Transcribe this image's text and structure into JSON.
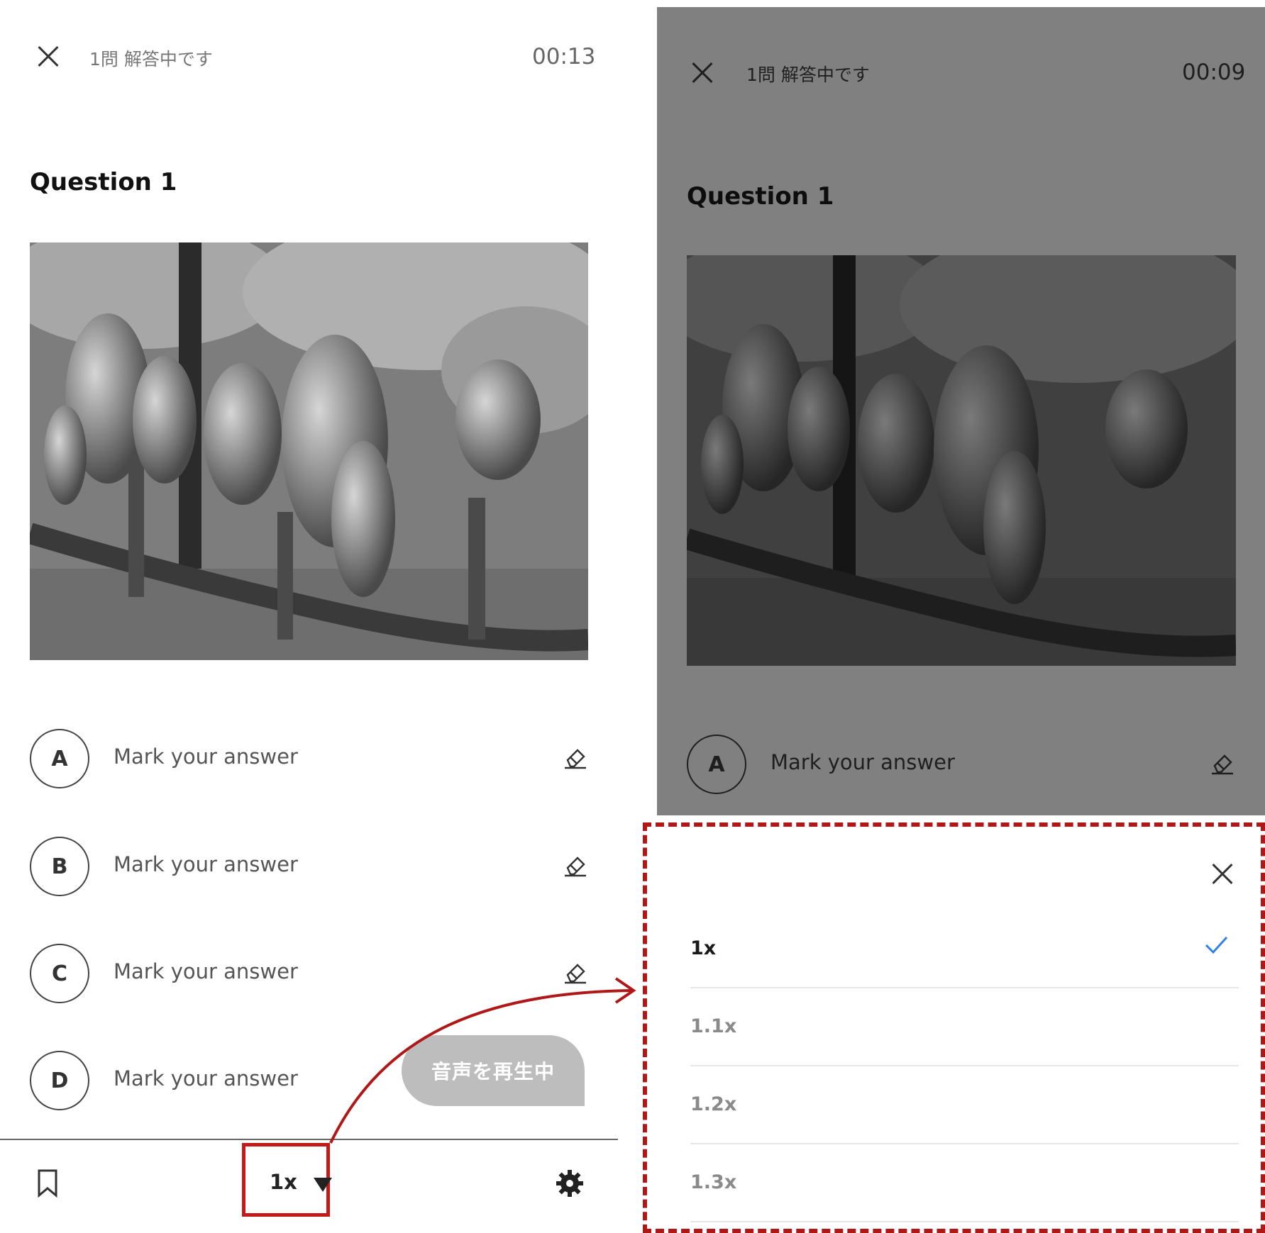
{
  "left_panel": {
    "status": "1問 解答中です",
    "timer": "00:13",
    "question_title": "Question 1",
    "options": [
      {
        "letter": "A",
        "text": "Mark your answer"
      },
      {
        "letter": "B",
        "text": "Mark your answer"
      },
      {
        "letter": "C",
        "text": "Mark your answer"
      },
      {
        "letter": "D",
        "text": "Mark your answer"
      }
    ],
    "play_button": "音声を再生中",
    "bottom_bar": {
      "speed": "1x"
    }
  },
  "right_panel": {
    "status": "1問 解答中です",
    "timer": "00:09",
    "question_title": "Question 1",
    "option_a": {
      "letter": "A",
      "text": "Mark your answer"
    },
    "speed_sheet": {
      "options": [
        {
          "label": "1x",
          "selected": true
        },
        {
          "label": "1.1x",
          "selected": false
        },
        {
          "label": "1.2x",
          "selected": false
        },
        {
          "label": "1.3x",
          "selected": false
        }
      ]
    }
  },
  "colors": {
    "highlight": "#c41a1a",
    "dim_overlay": "#808080",
    "accent_check": "#2f80ed"
  }
}
